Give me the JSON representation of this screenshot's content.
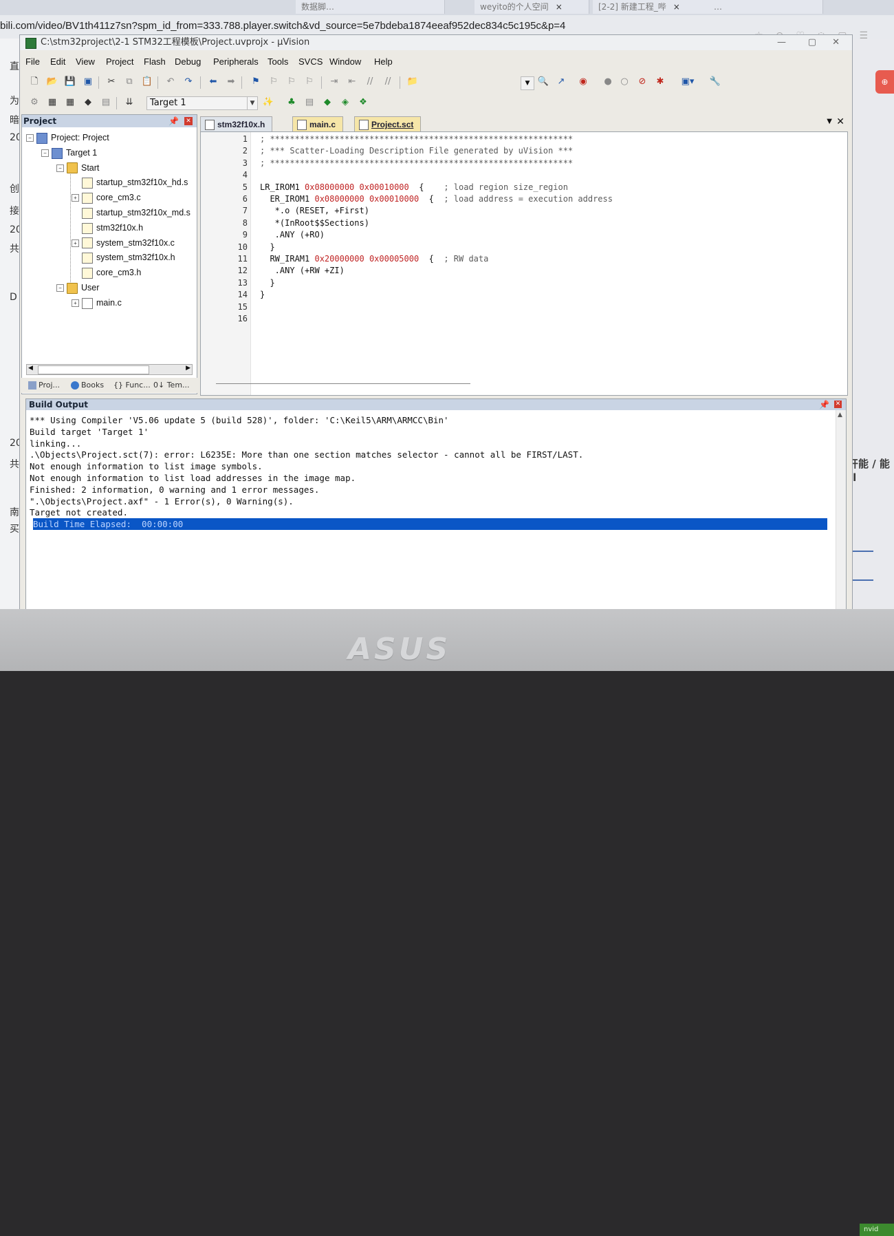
{
  "browser": {
    "tabs": [
      {
        "label": "数据脚…",
        "close": "×"
      },
      {
        "label": "weyito的个人空间",
        "close": "×"
      },
      {
        "label": "[2-2] 新建工程_哔",
        "close": "×"
      },
      {
        "label": "…",
        "close": ""
      }
    ],
    "url": "bili.com/video/BV1th411z7sn?spm_id_from=333.788.player.switch&vd_source=5e7bdeba1874eeaf952dec834c5c195c&p=4"
  },
  "window": {
    "title": "C:\\stm32project\\2-1 STM32工程模板\\Project.uvprojx - µVision"
  },
  "menu": [
    "File",
    "Edit",
    "View",
    "Project",
    "Flash",
    "Debug",
    "Peripherals",
    "Tools",
    "SVCS",
    "Window",
    "Help"
  ],
  "toolbar": {
    "target": "Target 1"
  },
  "project_panel": {
    "title": "Project",
    "tree": [
      {
        "label": "Project: Project",
        "level": 0,
        "expander": "⊟",
        "icon": "proj"
      },
      {
        "label": "Target 1",
        "level": 1,
        "expander": "⊟",
        "icon": "proj"
      },
      {
        "label": "Start",
        "level": 2,
        "expander": "⊟",
        "icon": "folder"
      },
      {
        "label": "startup_stm32f10x_hd.s",
        "level": 3,
        "expander": "",
        "icon": "hfile"
      },
      {
        "label": "core_cm3.c",
        "level": 3,
        "expander": "⊞",
        "icon": "hfile"
      },
      {
        "label": "startup_stm32f10x_md.s",
        "level": 3,
        "expander": "",
        "icon": "hfile"
      },
      {
        "label": "stm32f10x.h",
        "level": 3,
        "expander": "",
        "icon": "hfile"
      },
      {
        "label": "system_stm32f10x.c",
        "level": 3,
        "expander": "⊞",
        "icon": "hfile"
      },
      {
        "label": "system_stm32f10x.h",
        "level": 3,
        "expander": "",
        "icon": "hfile"
      },
      {
        "label": "core_cm3.h",
        "level": 3,
        "expander": "",
        "icon": "hfile"
      },
      {
        "label": "User",
        "level": 2,
        "expander": "⊟",
        "icon": "folder"
      },
      {
        "label": "main.c",
        "level": 3,
        "expander": "⊞",
        "icon": "file"
      }
    ],
    "bottom_tabs": [
      "Proj...",
      "Books",
      "{} Func...",
      "0↓ Tem..."
    ]
  },
  "editor": {
    "tabs": [
      {
        "label": "stm32f10x.h",
        "active": false
      },
      {
        "label": "main.c",
        "active": false
      },
      {
        "label": "Project.sct",
        "active": true
      }
    ],
    "lines": [
      {
        "n": "1",
        "parts": [
          {
            "t": "; *************************************************************",
            "c": "comment"
          }
        ]
      },
      {
        "n": "2",
        "parts": [
          {
            "t": "; *** Scatter-Loading Description File generated by uVision ***",
            "c": "comment"
          }
        ]
      },
      {
        "n": "3",
        "parts": [
          {
            "t": "; *************************************************************",
            "c": "comment"
          }
        ]
      },
      {
        "n": "4",
        "parts": []
      },
      {
        "n": "5",
        "parts": [
          {
            "t": "LR_IROM1 ",
            "c": "text"
          },
          {
            "t": "0x08000000 0x00010000",
            "c": "num"
          },
          {
            "t": "  {    ",
            "c": "text"
          },
          {
            "t": "; load region size_region",
            "c": "comment"
          }
        ]
      },
      {
        "n": "6",
        "parts": [
          {
            "t": "  ER_IROM1 ",
            "c": "text"
          },
          {
            "t": "0x08000000 0x00010000",
            "c": "num"
          },
          {
            "t": "  {  ",
            "c": "text"
          },
          {
            "t": "; load address = execution address",
            "c": "comment"
          }
        ]
      },
      {
        "n": "7",
        "parts": [
          {
            "t": "   *.o (RESET, +First)",
            "c": "text"
          }
        ]
      },
      {
        "n": "8",
        "parts": [
          {
            "t": "   *(InRoot$$Sections)",
            "c": "text"
          }
        ]
      },
      {
        "n": "9",
        "parts": [
          {
            "t": "   .ANY (+RO)",
            "c": "text"
          }
        ]
      },
      {
        "n": "10",
        "parts": [
          {
            "t": "  }",
            "c": "text"
          }
        ]
      },
      {
        "n": "11",
        "parts": [
          {
            "t": "  RW_IRAM1 ",
            "c": "text"
          },
          {
            "t": "0x20000000 0x00005000",
            "c": "num"
          },
          {
            "t": "  {  ",
            "c": "text"
          },
          {
            "t": "; RW data",
            "c": "comment"
          }
        ]
      },
      {
        "n": "12",
        "parts": [
          {
            "t": "   .ANY (+RW +ZI)",
            "c": "text"
          }
        ]
      },
      {
        "n": "13",
        "parts": [
          {
            "t": "  }",
            "c": "text"
          }
        ]
      },
      {
        "n": "14",
        "parts": [
          {
            "t": "}",
            "c": "text"
          }
        ]
      },
      {
        "n": "15",
        "parts": []
      },
      {
        "n": "16",
        "parts": []
      }
    ]
  },
  "build_output": {
    "title": "Build Output",
    "lines": [
      "*** Using Compiler 'V5.06 update 5 (build 528)', folder: 'C:\\Keil5\\ARM\\ARMCC\\Bin'",
      "Build target 'Target 1'",
      "linking...",
      ".\\Objects\\Project.sct(7): error: L6235E: More than one section matches selector - cannot all be FIRST/LAST.",
      "Not enough information to list image symbols.",
      "Not enough information to list load addresses in the image map.",
      "Finished: 2 information, 0 warning and 1 error messages.",
      "\".\\Objects\\Project.axf\" - 1 Error(s), 0 Warning(s).",
      "Target not created.",
      "Build Time Elapsed:  00:00:00"
    ],
    "selected_line": 9
  },
  "page_side": {
    "left_chars": [
      "直",
      "为",
      "暗",
      "20",
      "创",
      "接",
      "20",
      "共",
      "D",
      "20",
      "共",
      "南",
      "买"
    ],
    "right_blurred": "打开能 / 能够tl",
    "sticker": "nvid"
  },
  "bezel": {
    "logo": "ASUS"
  },
  "colors": {
    "panel_header": "#c9d4e4",
    "selection": "#0a56c6",
    "error_red": "#d23b2e",
    "hex_number": "#c02424"
  }
}
